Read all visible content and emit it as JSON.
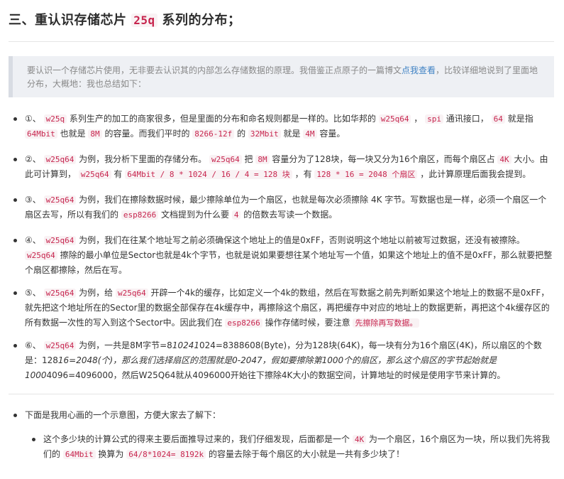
{
  "heading": {
    "prefix": "三、重认识存储芯片 ",
    "code": "25q",
    "suffix": " 系列的分布；"
  },
  "quote": {
    "text1": "要认识一个存储芯片使用，无非要去认识其的内部怎么存储数据的原理。我借鉴正点原子的一篇博文",
    "link": "点我查看",
    "text2": "，比较详细地说到了里面地分布，大概地：我也总结如下："
  },
  "items": {
    "i1": {
      "a": "①、 ",
      "c1": "w25q",
      "b": " 系列生产的加工的商家很多，但是里面的分布和命名规则都是一样的。比如华邦的 ",
      "c2": "w25q64",
      "d": " ， ",
      "c3": "spi",
      "e": " 通讯接口， ",
      "c4": "64",
      "f": " 就是指 ",
      "c5": "64Mbit",
      "g": " 也就是 ",
      "c6": "8M",
      "h": " 的容量。而我们平时的 ",
      "c7": "8266-12f",
      "i": " 的 ",
      "c8": "32Mbit",
      "j": " 就是 ",
      "c9": "4M",
      "k": " 容量。"
    },
    "i2": {
      "a": "②、 ",
      "c1": "w25q64",
      "b": " 为例，我分析下里面的存储分布。 ",
      "c2": "w25q64",
      "d": " 把 ",
      "c3": "8M",
      "e": " 容量分为了128块，每一块又分为16个扇区，而每个扇区占 ",
      "c4": "4K",
      "f": " 大小。由此可计算到， ",
      "c5": "w25q64",
      "g": " 有 ",
      "c6": "64Mbit / 8 * 1024 / 16 / 4 = 128 块",
      "h": " ，有 ",
      "c7": "128 * 16 = 2048 个扇区",
      "i": " ，此计算原理后面我会提到。"
    },
    "i3": {
      "a": "③、 ",
      "c1": "w25q64",
      "b": " 为例，我们在擦除数据时候，最少擦除单位为一个扇区，也就是每次必须擦除 4K 字节。写数据也是一样，必须一个扇区一个扇区去写，所以有我们的 ",
      "c2": "esp8266",
      "d": " 文档提到为什么要 ",
      "c3": "4",
      "e": " 的倍数去写读一个数据。"
    },
    "i4": {
      "a": "④、 ",
      "c1": "w25q64",
      "b": " 为例，我们在往某个地址写之前必须确保这个地址上的值是0xFF，否则说明这个地址以前被写过数据，还没有被擦除。 ",
      "c2": "w25q64",
      "d": " 擦除的最小单位是Sector也就是4k个字节，也就是说如果要想往某个地址写一个值，如果这个地址上的值不是0xFF，那么就要把整个扇区都擦除，然后在写。"
    },
    "i5": {
      "a": "⑤、 ",
      "c1": "w25q64",
      "b": " 为例，给 ",
      "c2": "w25q64",
      "d": " 开辟一个4k的缓存，比如定义一个4k的数组，然后在写数据之前先判断如果这个地址上的数据不是0xFF，就先把这个地址所在的Sector里的数据全部保存在4k缓存中，再擦除这个扇区，再把缓存中对应的地址上的数据更新，再把这个4k缓存区的所有数据一次性的写入到这个Sector中。因此我们在 ",
      "c3": "esp8266",
      "e": " 操作存储时候，要注意 ",
      "c4": "先擦除再写数据。"
    },
    "i6": {
      "a": "⑥、 ",
      "c1": "w25q64",
      "b": " 为例，一共是8M字节=8",
      "it1": "10241",
      "c": "024=8388608(Byte)，分为128块(64K)，每一块有分为16个扇区(4K)，所以扇区的个数是：128",
      "it2": "16=2048(个)，那么我们选择扇区的范围就是0-2047，假如要擦除第1000个的扇区，那么这个扇区的字节起始就是1000",
      "d": "4096=4096000，然后W25Q64就从4096000开始往下擦除4K大小的数据空间，计算地址的时候是使用字节来计算的。"
    }
  },
  "bottom": {
    "intro": "下面是我用心画的一个示意图，方便大家去了解下：",
    "sub": {
      "a": "这个多少块的计算公式的得来主要后面推导过来的，我们仔细发现，后面都是一个 ",
      "c1": "4K",
      "b": " 为一个扇区，16个扇区为一块，所以我们先将我们的 ",
      "c2": "64Mbit",
      "d": " 换算为 ",
      "c3": "64/8*1024= 8192k",
      "e": " 的容量去除于每个扇区的大小就是一共有多少块了！"
    }
  }
}
